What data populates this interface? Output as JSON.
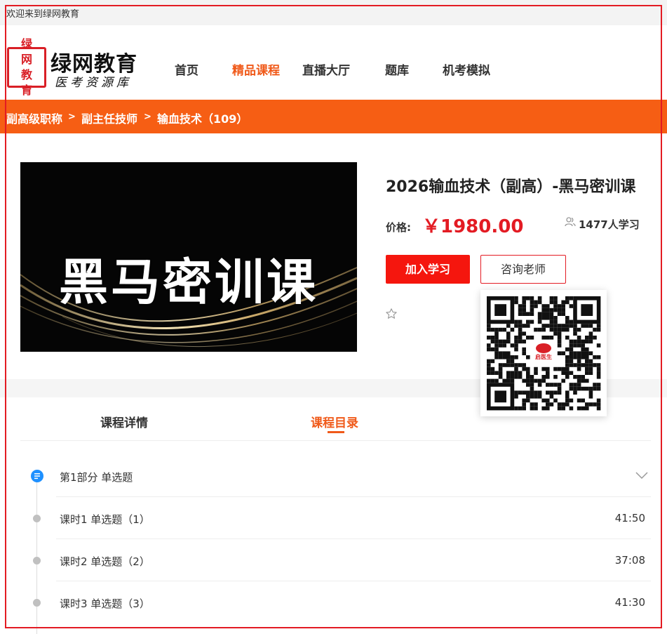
{
  "topbar": {
    "welcome": "欢迎来到绿网教育"
  },
  "logo": {
    "seal": [
      "绿",
      "网",
      "教",
      "育"
    ],
    "title": "绿网教育",
    "subtitle": "医考资源库"
  },
  "nav": [
    {
      "label": "首页",
      "active": false
    },
    {
      "label": "精品课程",
      "active": true
    },
    {
      "label": "直播大厅",
      "active": false
    },
    {
      "label": "题库",
      "active": false
    },
    {
      "label": "机考模拟",
      "active": false
    }
  ],
  "breadcrumb": {
    "items": [
      "副高级职称",
      "副主任技师",
      "输血技术（109）"
    ],
    "separator": ">"
  },
  "course": {
    "cover_text": "黑马密训课",
    "title": "2026输血技术（副高）-黑马密训课",
    "price_label": "价格:",
    "price": "￥1980.00",
    "learners": "1477人学习",
    "join_button": "加入学习",
    "ask_button": "咨询老师",
    "qr_center_text": "启医生"
  },
  "tabs": [
    {
      "label": "课程详情",
      "active": false
    },
    {
      "label": "课程目录",
      "active": true
    }
  ],
  "catalog": {
    "section": {
      "title": "第1部分  单选题"
    },
    "lessons": [
      {
        "label": "课时1  单选题（1）",
        "duration": "41:50"
      },
      {
        "label": "课时2  单选题（2）",
        "duration": "37:08"
      },
      {
        "label": "课时3  单选题（3）",
        "duration": "41:30"
      }
    ]
  },
  "colors": {
    "accent": "#f65e14",
    "price": "#e31b23",
    "button": "#f5160e",
    "info_icon": "#1e90ff"
  }
}
